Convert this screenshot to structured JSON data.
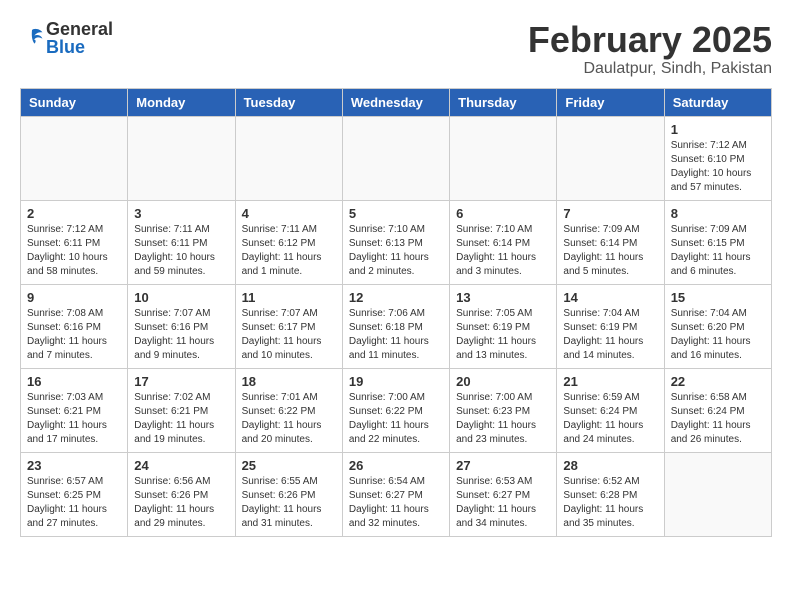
{
  "logo": {
    "general": "General",
    "blue": "Blue"
  },
  "header": {
    "month": "February 2025",
    "location": "Daulatpur, Sindh, Pakistan"
  },
  "weekdays": [
    "Sunday",
    "Monday",
    "Tuesday",
    "Wednesday",
    "Thursday",
    "Friday",
    "Saturday"
  ],
  "weeks": [
    [
      {
        "day": "",
        "info": ""
      },
      {
        "day": "",
        "info": ""
      },
      {
        "day": "",
        "info": ""
      },
      {
        "day": "",
        "info": ""
      },
      {
        "day": "",
        "info": ""
      },
      {
        "day": "",
        "info": ""
      },
      {
        "day": "1",
        "info": "Sunrise: 7:12 AM\nSunset: 6:10 PM\nDaylight: 10 hours\nand 57 minutes."
      }
    ],
    [
      {
        "day": "2",
        "info": "Sunrise: 7:12 AM\nSunset: 6:11 PM\nDaylight: 10 hours\nand 58 minutes."
      },
      {
        "day": "3",
        "info": "Sunrise: 7:11 AM\nSunset: 6:11 PM\nDaylight: 10 hours\nand 59 minutes."
      },
      {
        "day": "4",
        "info": "Sunrise: 7:11 AM\nSunset: 6:12 PM\nDaylight: 11 hours\nand 1 minute."
      },
      {
        "day": "5",
        "info": "Sunrise: 7:10 AM\nSunset: 6:13 PM\nDaylight: 11 hours\nand 2 minutes."
      },
      {
        "day": "6",
        "info": "Sunrise: 7:10 AM\nSunset: 6:14 PM\nDaylight: 11 hours\nand 3 minutes."
      },
      {
        "day": "7",
        "info": "Sunrise: 7:09 AM\nSunset: 6:14 PM\nDaylight: 11 hours\nand 5 minutes."
      },
      {
        "day": "8",
        "info": "Sunrise: 7:09 AM\nSunset: 6:15 PM\nDaylight: 11 hours\nand 6 minutes."
      }
    ],
    [
      {
        "day": "9",
        "info": "Sunrise: 7:08 AM\nSunset: 6:16 PM\nDaylight: 11 hours\nand 7 minutes."
      },
      {
        "day": "10",
        "info": "Sunrise: 7:07 AM\nSunset: 6:16 PM\nDaylight: 11 hours\nand 9 minutes."
      },
      {
        "day": "11",
        "info": "Sunrise: 7:07 AM\nSunset: 6:17 PM\nDaylight: 11 hours\nand 10 minutes."
      },
      {
        "day": "12",
        "info": "Sunrise: 7:06 AM\nSunset: 6:18 PM\nDaylight: 11 hours\nand 11 minutes."
      },
      {
        "day": "13",
        "info": "Sunrise: 7:05 AM\nSunset: 6:19 PM\nDaylight: 11 hours\nand 13 minutes."
      },
      {
        "day": "14",
        "info": "Sunrise: 7:04 AM\nSunset: 6:19 PM\nDaylight: 11 hours\nand 14 minutes."
      },
      {
        "day": "15",
        "info": "Sunrise: 7:04 AM\nSunset: 6:20 PM\nDaylight: 11 hours\nand 16 minutes."
      }
    ],
    [
      {
        "day": "16",
        "info": "Sunrise: 7:03 AM\nSunset: 6:21 PM\nDaylight: 11 hours\nand 17 minutes."
      },
      {
        "day": "17",
        "info": "Sunrise: 7:02 AM\nSunset: 6:21 PM\nDaylight: 11 hours\nand 19 minutes."
      },
      {
        "day": "18",
        "info": "Sunrise: 7:01 AM\nSunset: 6:22 PM\nDaylight: 11 hours\nand 20 minutes."
      },
      {
        "day": "19",
        "info": "Sunrise: 7:00 AM\nSunset: 6:22 PM\nDaylight: 11 hours\nand 22 minutes."
      },
      {
        "day": "20",
        "info": "Sunrise: 7:00 AM\nSunset: 6:23 PM\nDaylight: 11 hours\nand 23 minutes."
      },
      {
        "day": "21",
        "info": "Sunrise: 6:59 AM\nSunset: 6:24 PM\nDaylight: 11 hours\nand 24 minutes."
      },
      {
        "day": "22",
        "info": "Sunrise: 6:58 AM\nSunset: 6:24 PM\nDaylight: 11 hours\nand 26 minutes."
      }
    ],
    [
      {
        "day": "23",
        "info": "Sunrise: 6:57 AM\nSunset: 6:25 PM\nDaylight: 11 hours\nand 27 minutes."
      },
      {
        "day": "24",
        "info": "Sunrise: 6:56 AM\nSunset: 6:26 PM\nDaylight: 11 hours\nand 29 minutes."
      },
      {
        "day": "25",
        "info": "Sunrise: 6:55 AM\nSunset: 6:26 PM\nDaylight: 11 hours\nand 31 minutes."
      },
      {
        "day": "26",
        "info": "Sunrise: 6:54 AM\nSunset: 6:27 PM\nDaylight: 11 hours\nand 32 minutes."
      },
      {
        "day": "27",
        "info": "Sunrise: 6:53 AM\nSunset: 6:27 PM\nDaylight: 11 hours\nand 34 minutes."
      },
      {
        "day": "28",
        "info": "Sunrise: 6:52 AM\nSunset: 6:28 PM\nDaylight: 11 hours\nand 35 minutes."
      },
      {
        "day": "",
        "info": ""
      }
    ]
  ]
}
